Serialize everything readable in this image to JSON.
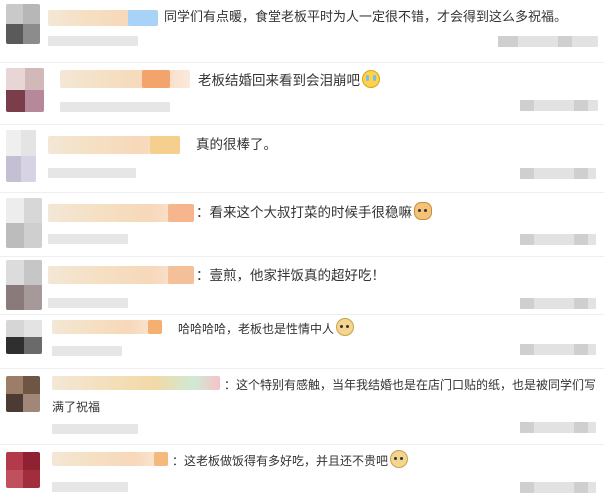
{
  "comments": [
    {
      "text": "同学们有点暖，食堂老板平时为人一定很不错，才会得到这么多祝福。",
      "emoji": ""
    },
    {
      "text": "老板结婚回来看到会泪崩吧",
      "emoji": "crying-face"
    },
    {
      "text": "真的很棒了。",
      "emoji": ""
    },
    {
      "text": "：看来这个大叔打菜的时候手很稳嘛",
      "emoji": "cat-face"
    },
    {
      "text": "：壹煎，他家拌饭真的超好吃！",
      "emoji": ""
    },
    {
      "text": "哈哈哈哈，老板也是性情中人",
      "emoji": "doge-face"
    },
    {
      "text": "：这个特别有感触，当年我结婚也是在店门口贴的纸，也是被同学们写满了祝福",
      "emoji": ""
    },
    {
      "text": "：这老板做饭得有多好吃，并且还不贵吧",
      "emoji": "doge-face"
    }
  ],
  "colors": {
    "text": "#333333",
    "background": "#ffffff",
    "blurred_meta": "#e6e6e6"
  }
}
